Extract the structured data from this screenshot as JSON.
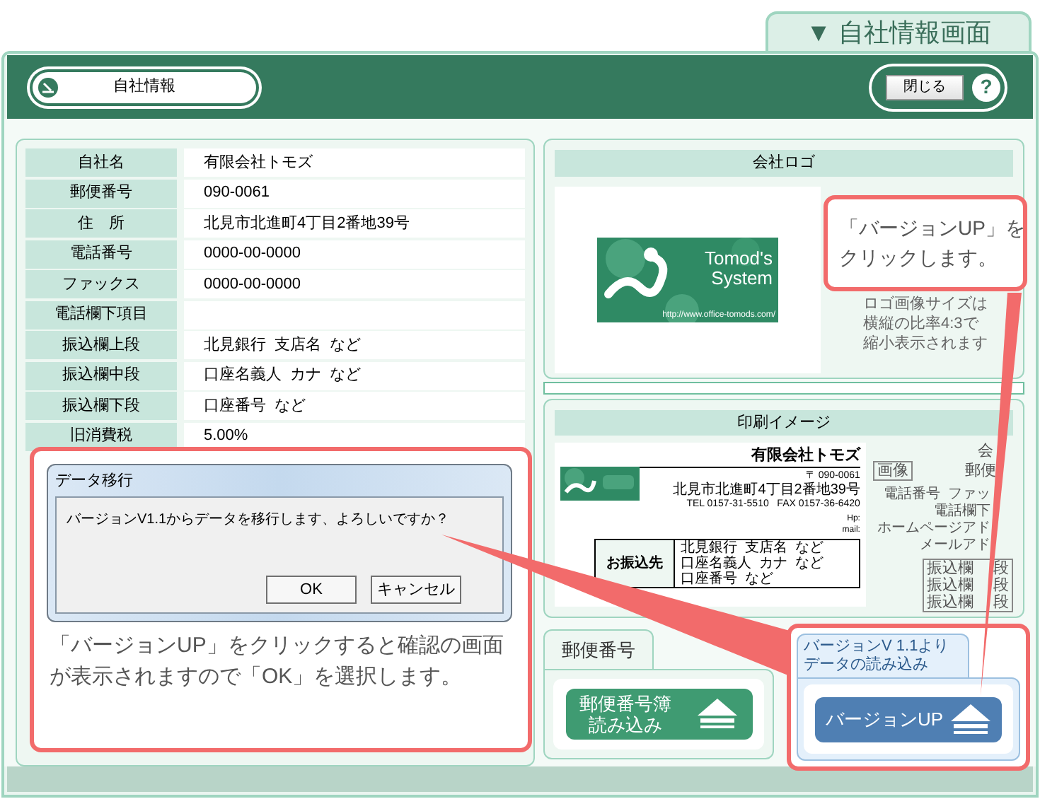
{
  "screen_tab": "▼ 自社情報画面",
  "header": {
    "title_button": "自社情報",
    "close_button": "閉じる",
    "help_button": "?"
  },
  "company_fields": [
    {
      "label": "自社名",
      "value": "有限会社トモズ"
    },
    {
      "label": "郵便番号",
      "value": "090-0061"
    },
    {
      "label": "住　所",
      "value": "北見市北進町4丁目2番地39号"
    },
    {
      "label": "電話番号",
      "value": "0000-00-0000"
    },
    {
      "label": "ファックス",
      "value": "0000-00-0000"
    },
    {
      "label": "電話欄下項目"
    },
    {
      "label": "振込欄上段",
      "value": "北見銀行  支店名  など"
    },
    {
      "label": "振込欄中段",
      "value": "口座名義人  カナ  など"
    },
    {
      "label": "振込欄下段",
      "value": "口座番号  など"
    },
    {
      "label": "旧消費税",
      "value": "5.00%"
    }
  ],
  "logo_panel": {
    "title": "会社ロゴ",
    "logo_lines": [
      "Tomod's",
      "System"
    ],
    "logo_url": "http://www.office-tomods.com/",
    "note_lines": [
      "ロゴ画像サイズは",
      "横縦の比率4:3で",
      "縮小表示されます"
    ]
  },
  "print_preview": {
    "title": "印刷イメージ",
    "company": "有限会社トモズ",
    "postal": "〒 090-0061",
    "address": "北見市北進町4丁目2番地39号",
    "tel": "TEL 0157-31-5510   FAX 0157-36-6420",
    "hp": "Hp:",
    "mail": "mail:",
    "bank_label": "お振込先",
    "bank_lines": [
      "北見銀行  支店名  など",
      "口座名義人  カナ  など",
      "口座番号  など"
    ],
    "side_top": "会",
    "side_image": "画像",
    "side_postal": "郵便",
    "side_lines": [
      "電話番号  ファッ",
      "電話欄下",
      "ホームページアド",
      "メールアド"
    ],
    "side_box_left": [
      "振込欄",
      "振込欄",
      "振込欄"
    ],
    "side_box_right": [
      "段",
      "段",
      "段"
    ]
  },
  "postal_panel": {
    "tab": "郵便番号",
    "button_lines": [
      "郵便番号簿",
      "読み込み"
    ]
  },
  "version_panel": {
    "tab_lines": [
      "バージョンV 1.1より",
      "データの読み込み"
    ],
    "button": "バージョンUP"
  },
  "dialog": {
    "title": "データ移行",
    "message": "バージョンV1.1からデータを移行します、よろしいですか？",
    "buttons": [
      "OK",
      "キャンセル"
    ]
  },
  "callouts": [
    {
      "lines": [
        "「バージョンUP」を",
        "クリックします。"
      ]
    },
    {
      "lines": [
        "「バージョンUP」をクリックすると確認の画面が表示されますので「OK」を選択します。"
      ]
    }
  ]
}
